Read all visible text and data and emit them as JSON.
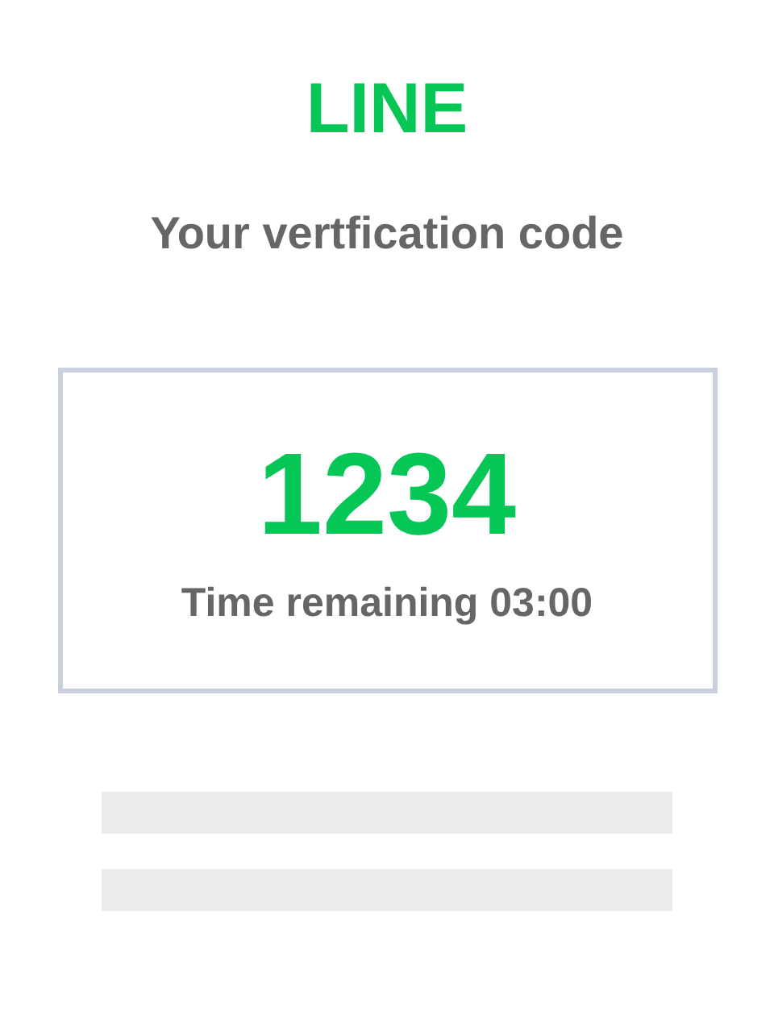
{
  "logo": "LINE",
  "title": "Your vertfication code",
  "code_card": {
    "code": "1234",
    "timer": "Time remaining 03:00"
  }
}
